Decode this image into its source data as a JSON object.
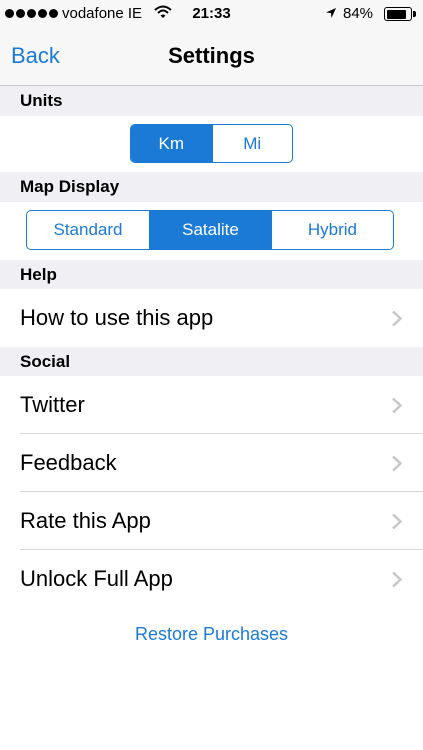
{
  "status_bar": {
    "carrier": "vodafone IE",
    "time": "21:33",
    "battery": "84%",
    "battery_level": 0.84,
    "signal_icon": "signal-dots-icon",
    "wifi_icon": "wifi-icon",
    "location_icon": "location-arrow-icon",
    "battery_icon": "battery-icon"
  },
  "navbar": {
    "back_label": "Back",
    "title": "Settings"
  },
  "sections": {
    "units": {
      "header": "Units",
      "options": [
        "Km",
        "Mi"
      ],
      "selected": "Km"
    },
    "map_display": {
      "header": "Map Display",
      "options": [
        "Standard",
        "Satalite",
        "Hybrid"
      ],
      "selected": "Satalite"
    },
    "help": {
      "header": "Help",
      "items": [
        "How to use this app"
      ]
    },
    "social": {
      "header": "Social",
      "items": [
        "Twitter",
        "Feedback",
        "Rate this App",
        "Unlock Full App"
      ]
    }
  },
  "restore_label": "Restore Purchases",
  "colors": {
    "accent": "#1a7ad6",
    "group_background": "#efeff4",
    "bar_background": "#f7f7f8",
    "chevron": "#c7c7cc"
  }
}
